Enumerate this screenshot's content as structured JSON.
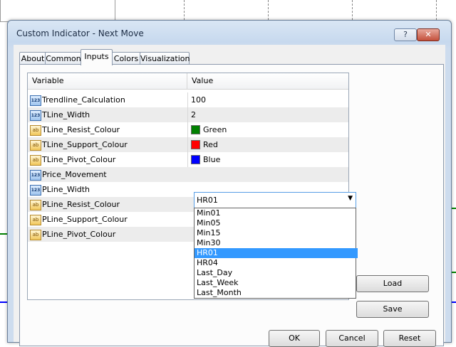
{
  "window": {
    "title": "Custom Indicator - Next Move",
    "help_label": "?",
    "close_label": "✕"
  },
  "tabs": [
    {
      "label": "About"
    },
    {
      "label": "Common"
    },
    {
      "label": "Inputs"
    },
    {
      "label": "Colors"
    },
    {
      "label": "Visualization"
    }
  ],
  "active_tab": "Inputs",
  "table": {
    "columns": [
      "Variable",
      "Value"
    ],
    "rows": [
      {
        "icon": "number-icon",
        "variable": "Trendline_Calculation",
        "value": "100"
      },
      {
        "icon": "number-icon",
        "variable": "TLine_Width",
        "value": "2"
      },
      {
        "icon": "color-icon",
        "variable": "TLine_Resist_Colour",
        "value": "Green",
        "swatch": "#008000"
      },
      {
        "icon": "color-icon",
        "variable": "TLine_Support_Colour",
        "value": "Red",
        "swatch": "#ff0000"
      },
      {
        "icon": "color-icon",
        "variable": "TLine_Pivot_Colour",
        "value": "Blue",
        "swatch": "#0000ff"
      },
      {
        "icon": "number-icon",
        "variable": "Price_Movement",
        "value": "HR01"
      },
      {
        "icon": "number-icon",
        "variable": "PLine_Width",
        "value": ""
      },
      {
        "icon": "color-icon",
        "variable": "PLine_Resist_Colour",
        "value": ""
      },
      {
        "icon": "color-icon",
        "variable": "PLine_Support_Colour",
        "value": ""
      },
      {
        "icon": "color-icon",
        "variable": "PLine_Pivot_Colour",
        "value": ""
      }
    ]
  },
  "dropdown": {
    "selected": "HR01",
    "options": [
      "Min01",
      "Min05",
      "Min15",
      "Min30",
      "HR01",
      "HR04",
      "Last_Day",
      "Last_Week",
      "Last_Month"
    ]
  },
  "buttons": {
    "load": "Load",
    "save": "Save",
    "ok": "OK",
    "cancel": "Cancel",
    "reset": "Reset"
  },
  "icons": {
    "number_icon_text": "123",
    "color_icon_text": "ab",
    "dropdown_arrow": "▼"
  },
  "colors": {
    "selection": "#3399ff",
    "chart_green": "#008000",
    "chart_blue": "#0000ff"
  }
}
